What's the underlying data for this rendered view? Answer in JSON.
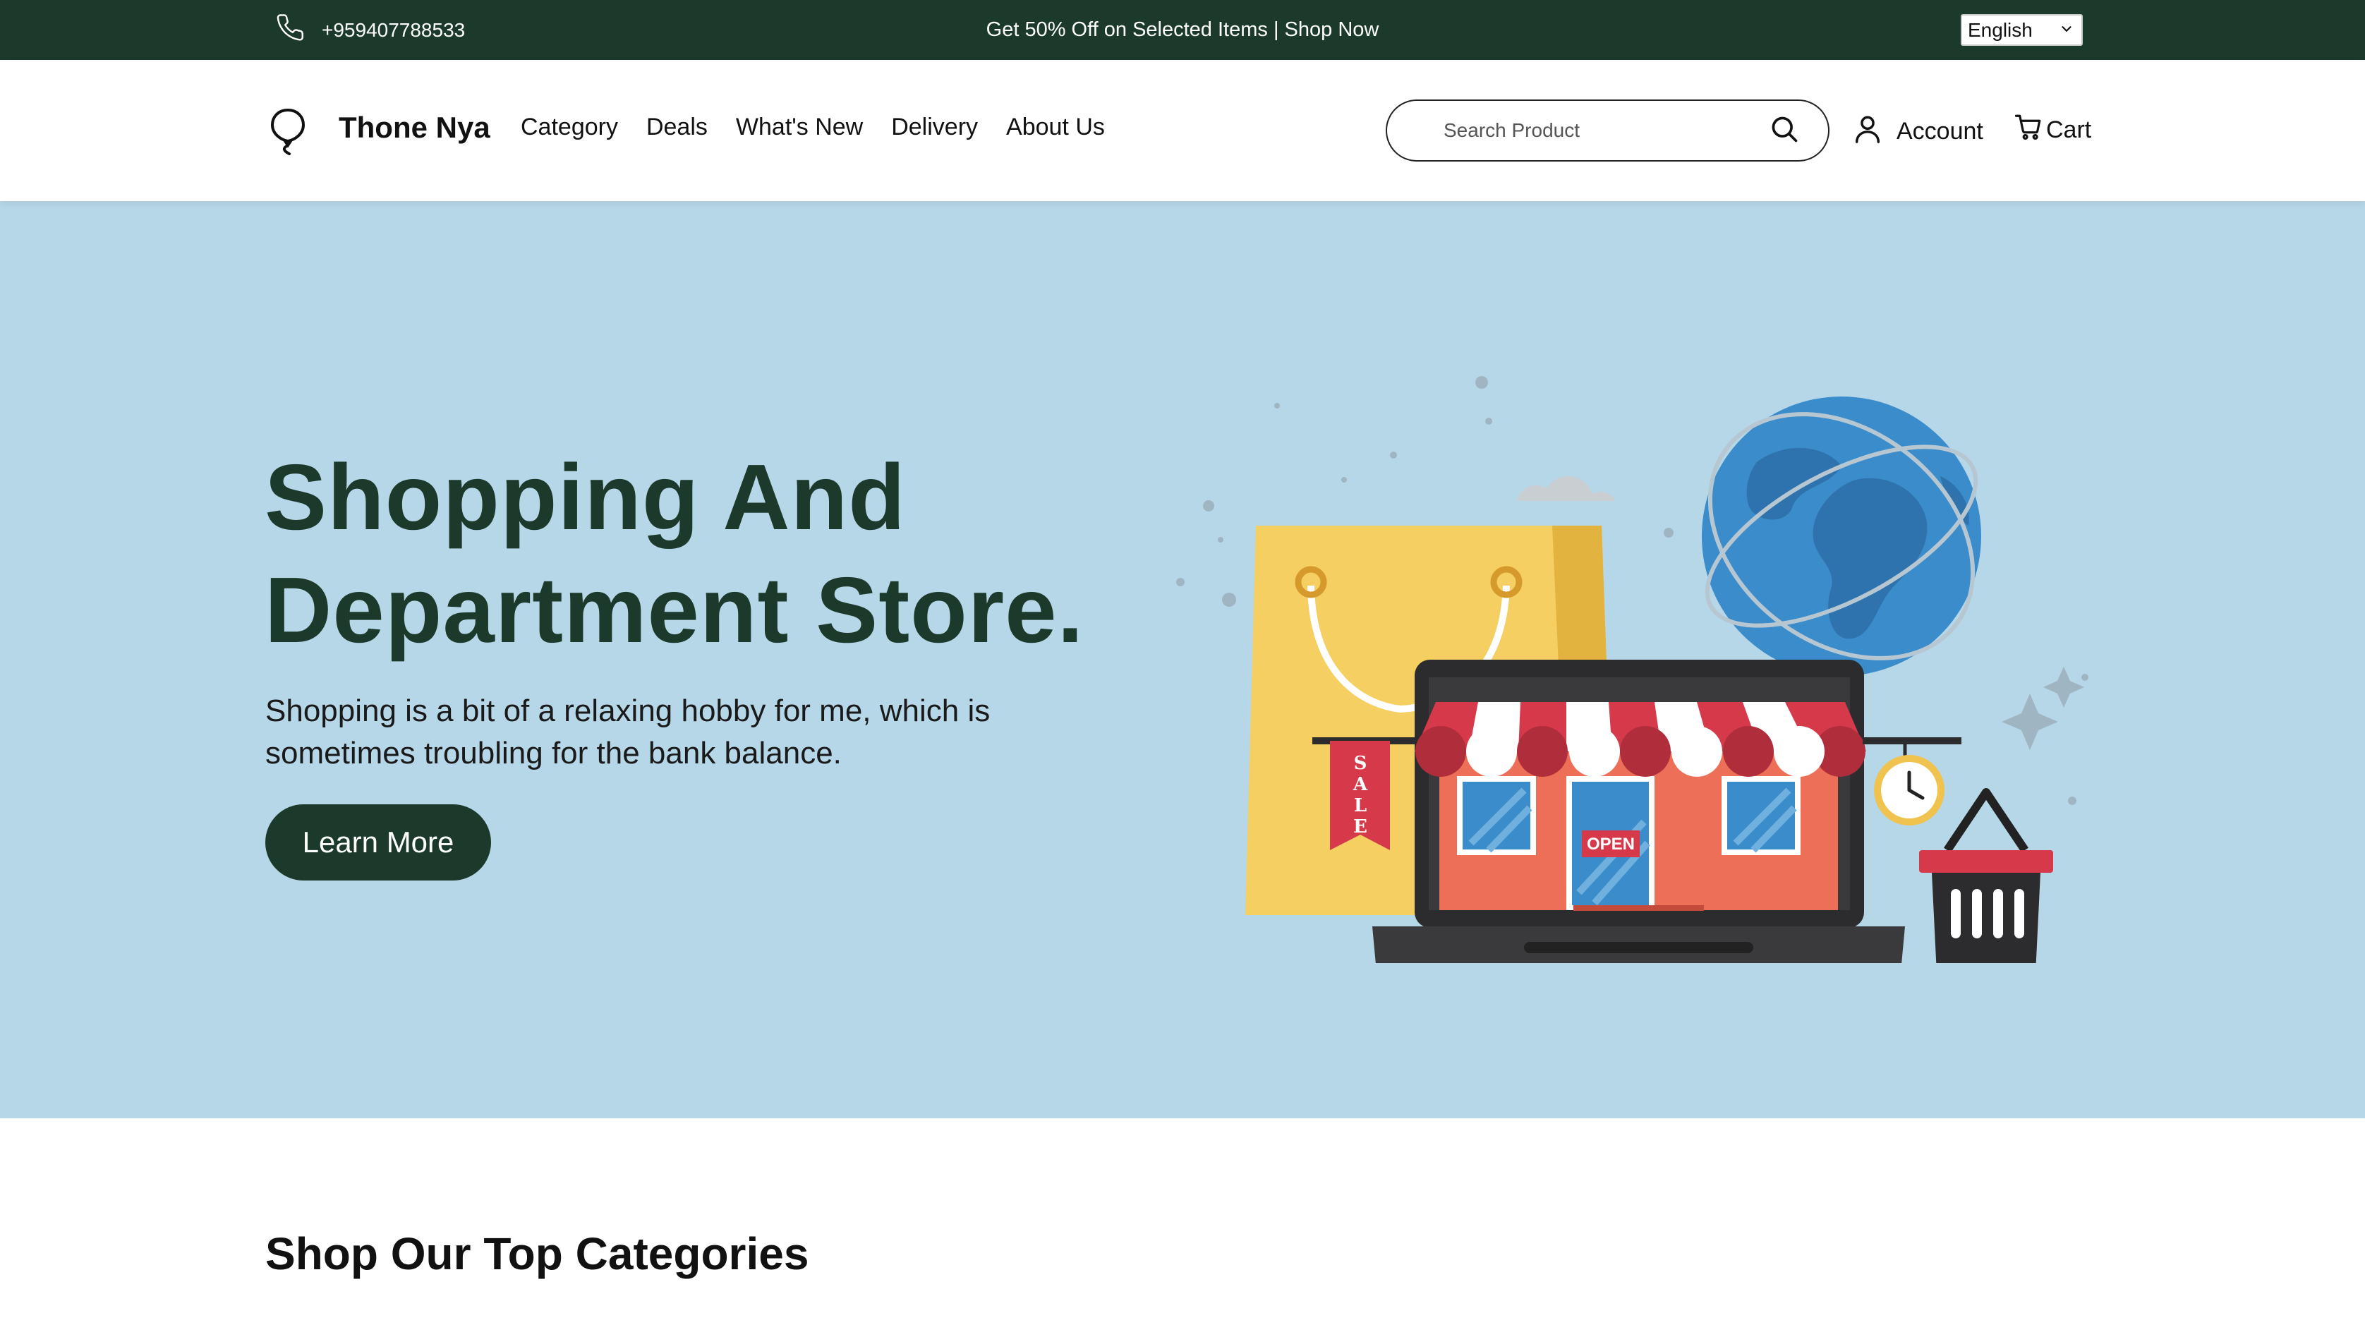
{
  "topbar": {
    "phone": "+959407788533",
    "promo": "Get 50% Off on Selected Items | Shop Now",
    "language": "English"
  },
  "nav": {
    "brand": "Thone Nya",
    "menu": [
      "Category",
      "Deals",
      "What's New",
      "Delivery",
      "About Us"
    ],
    "search_placeholder": "Search Product",
    "account_label": "Account",
    "cart_label": "Cart"
  },
  "hero": {
    "title_line1": "Shopping And",
    "title_line2": "Department Store.",
    "description": "Shopping is a bit of a relaxing hobby for me, which is sometimes troubling for the bank balance.",
    "cta": "Learn More",
    "illustration": {
      "sign_text": "OPEN",
      "ribbon_letters": [
        "S",
        "A",
        "L",
        "E"
      ]
    }
  },
  "categories": {
    "heading": "Shop Our Top Categories"
  },
  "colors": {
    "dark_green": "#1c3a2b",
    "hero_bg": "#b6d7e8"
  }
}
